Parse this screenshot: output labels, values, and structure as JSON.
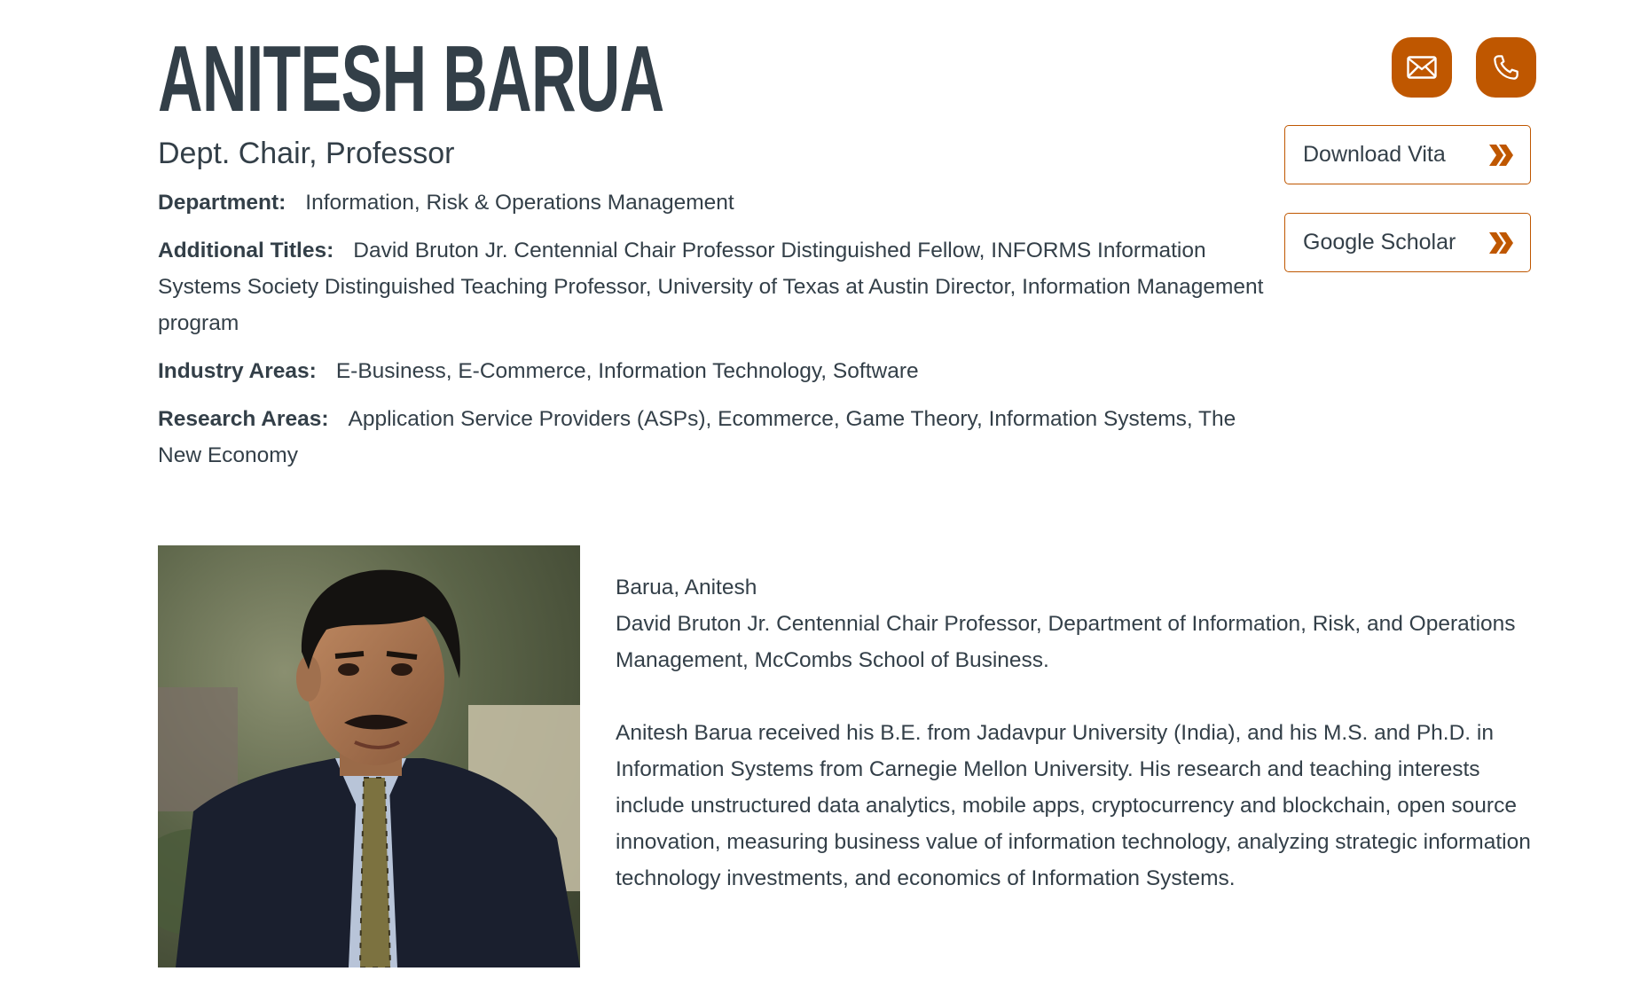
{
  "profile": {
    "name": "ANITESH BARUA",
    "title": "Dept. Chair, Professor",
    "department_label": "Department:",
    "department": "Information, Risk & Operations Management",
    "additional_titles_label": "Additional Titles:",
    "additional_titles": "David Bruton Jr. Centennial Chair Professor Distinguished Fellow, INFORMS Information Systems Society Distinguished Teaching Professor, University of Texas at Austin Director, Information Management program",
    "industry_label": "Industry Areas:",
    "industry": "E-Business, E-Commerce, Information Technology, Software",
    "research_label": "Research Areas:",
    "research": "Application Service Providers (ASPs), Ecommerce, Game Theory, Information Systems, The New Economy"
  },
  "actions": {
    "email_icon": "envelope-icon",
    "phone_icon": "phone-icon",
    "download_vita": "Download Vita",
    "google_scholar": "Google Scholar",
    "chevron_icon": "double-chevron-right-icon",
    "accent_color": "#bf5700"
  },
  "bio": {
    "heading_name": "Barua, Anitesh",
    "heading_position": "David Bruton Jr. Centennial Chair Professor, Department of Information, Risk, and Operations Management, McCombs School of Business.",
    "paragraph": "Anitesh Barua received his B.E. from Jadavpur University (India), and his M.S. and Ph.D. in Information Systems from Carnegie Mellon University. His research and teaching interests include unstructured data analytics, mobile apps, cryptocurrency and blockchain, open source innovation, measuring business value of information technology, analyzing strategic information technology investments, and economics of Information Systems."
  },
  "colors": {
    "text": "#333f48",
    "accent": "#bf5700"
  }
}
